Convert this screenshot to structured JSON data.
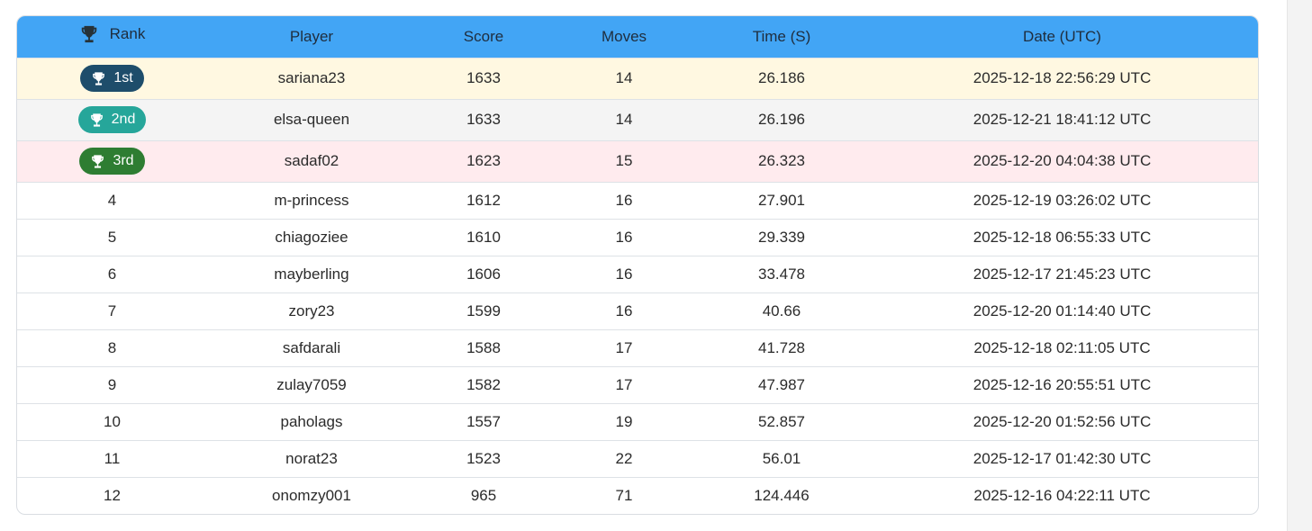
{
  "header": {
    "icon": "trophy-icon",
    "rank": "Rank",
    "player": "Player",
    "score": "Score",
    "moves": "Moves",
    "time": "Time (S)",
    "date": "Date (UTC)"
  },
  "colors": {
    "header_bg": "#42a5f5",
    "gold_badge": "#1e4d6b",
    "silver_badge": "#26a69a",
    "bronze_badge": "#2e7d32",
    "gold_row": "#fff8e1",
    "silver_row": "#f4f4f4",
    "bronze_row": "#ffebee"
  },
  "rows": [
    {
      "rank": "1st",
      "player": "sariana23",
      "score": "1633",
      "moves": "14",
      "time": "26.186",
      "date": "2025-12-18 22:56:29 UTC"
    },
    {
      "rank": "2nd",
      "player": "elsa-queen",
      "score": "1633",
      "moves": "14",
      "time": "26.196",
      "date": "2025-12-21 18:41:12 UTC"
    },
    {
      "rank": "3rd",
      "player": "sadaf02",
      "score": "1623",
      "moves": "15",
      "time": "26.323",
      "date": "2025-12-20 04:04:38 UTC"
    },
    {
      "rank": "4",
      "player": "m-princess",
      "score": "1612",
      "moves": "16",
      "time": "27.901",
      "date": "2025-12-19 03:26:02 UTC"
    },
    {
      "rank": "5",
      "player": "chiagoziee",
      "score": "1610",
      "moves": "16",
      "time": "29.339",
      "date": "2025-12-18 06:55:33 UTC"
    },
    {
      "rank": "6",
      "player": "mayberling",
      "score": "1606",
      "moves": "16",
      "time": "33.478",
      "date": "2025-12-17 21:45:23 UTC"
    },
    {
      "rank": "7",
      "player": "zory23",
      "score": "1599",
      "moves": "16",
      "time": "40.66",
      "date": "2025-12-20 01:14:40 UTC"
    },
    {
      "rank": "8",
      "player": "safdarali",
      "score": "1588",
      "moves": "17",
      "time": "41.728",
      "date": "2025-12-18 02:11:05 UTC"
    },
    {
      "rank": "9",
      "player": "zulay7059",
      "score": "1582",
      "moves": "17",
      "time": "47.987",
      "date": "2025-12-16 20:55:51 UTC"
    },
    {
      "rank": "10",
      "player": "paholags",
      "score": "1557",
      "moves": "19",
      "time": "52.857",
      "date": "2025-12-20 01:52:56 UTC"
    },
    {
      "rank": "11",
      "player": "norat23",
      "score": "1523",
      "moves": "22",
      "time": "56.01",
      "date": "2025-12-17 01:42:30 UTC"
    },
    {
      "rank": "12",
      "player": "onomzy001",
      "score": "965",
      "moves": "71",
      "time": "124.446",
      "date": "2025-12-16 04:22:11 UTC"
    }
  ]
}
